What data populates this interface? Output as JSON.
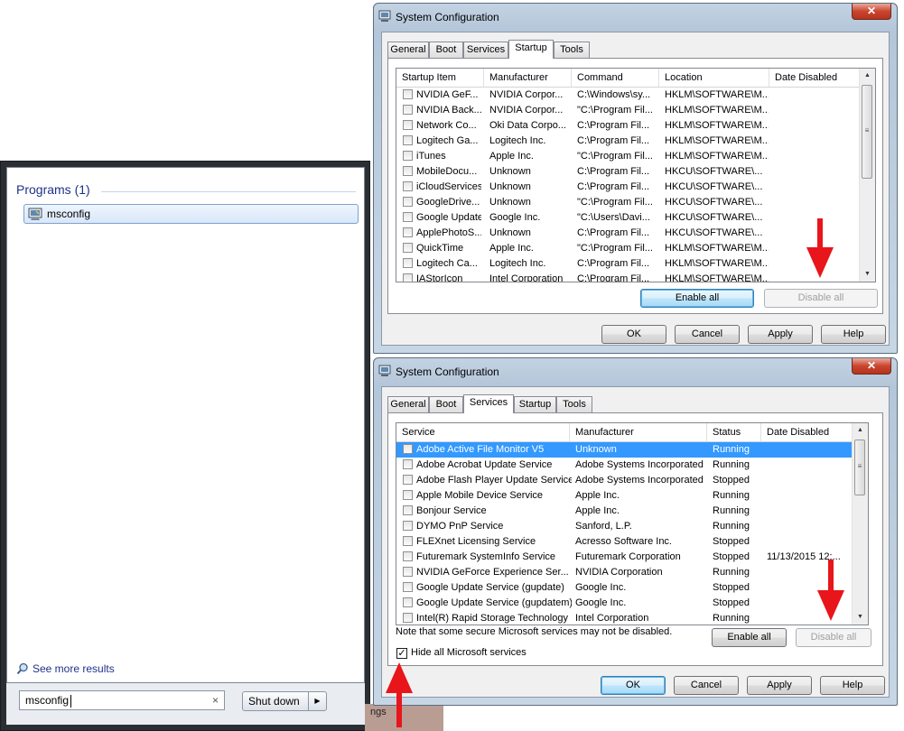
{
  "start_menu": {
    "programs_heading": "Programs (1)",
    "result_label": "msconfig",
    "see_more": "See more results",
    "search_value": "msconfig",
    "search_clear": "×",
    "shutdown_label": "Shut down",
    "shutdown_arrow": "▶"
  },
  "background": {
    "fragment_text": "ngs"
  },
  "colors": {
    "arrow": "#e8151b",
    "selection": "#3399ff",
    "accent": "#1e3287"
  },
  "window_startup": {
    "title": "System Configuration",
    "close_glyph": "✕",
    "tabs": [
      {
        "label": "General",
        "active": false
      },
      {
        "label": "Boot",
        "active": false
      },
      {
        "label": "Services",
        "active": false
      },
      {
        "label": "Startup",
        "active": true
      },
      {
        "label": "Tools",
        "active": false
      }
    ],
    "columns": [
      "Startup Item",
      "Manufacturer",
      "Command",
      "Location",
      "Date Disabled"
    ],
    "rows": [
      [
        "NVIDIA GeF...",
        "NVIDIA Corpor...",
        "C:\\Windows\\sy...",
        "HKLM\\SOFTWARE\\M...",
        ""
      ],
      [
        "NVIDIA Back...",
        "NVIDIA Corpor...",
        "\"C:\\Program Fil...",
        "HKLM\\SOFTWARE\\M...",
        ""
      ],
      [
        "Network Co...",
        "Oki Data Corpo...",
        "C:\\Program Fil...",
        "HKLM\\SOFTWARE\\M...",
        ""
      ],
      [
        "Logitech Ga...",
        "Logitech Inc.",
        "C:\\Program Fil...",
        "HKLM\\SOFTWARE\\M...",
        ""
      ],
      [
        "iTunes",
        "Apple Inc.",
        "\"C:\\Program Fil...",
        "HKLM\\SOFTWARE\\M...",
        ""
      ],
      [
        "MobileDocu...",
        "Unknown",
        "C:\\Program Fil...",
        "HKCU\\SOFTWARE\\...",
        ""
      ],
      [
        "iCloudServices",
        "Unknown",
        "C:\\Program Fil...",
        "HKCU\\SOFTWARE\\...",
        ""
      ],
      [
        "GoogleDrive...",
        "Unknown",
        "\"C:\\Program Fil...",
        "HKCU\\SOFTWARE\\...",
        ""
      ],
      [
        "Google Update",
        "Google Inc.",
        "\"C:\\Users\\Davi...",
        "HKCU\\SOFTWARE\\...",
        ""
      ],
      [
        "ApplePhotoS...",
        "Unknown",
        "C:\\Program Fil...",
        "HKCU\\SOFTWARE\\...",
        ""
      ],
      [
        "QuickTime",
        "Apple Inc.",
        "\"C:\\Program Fil...",
        "HKLM\\SOFTWARE\\M...",
        ""
      ],
      [
        "Logitech Ca...",
        "Logitech Inc.",
        "C:\\Program Fil...",
        "HKLM\\SOFTWARE\\M...",
        ""
      ],
      [
        "IAStorIcon",
        "Intel Corporation",
        "C:\\Program Fil...",
        "HKLM\\SOFTWARE\\M...",
        ""
      ]
    ],
    "enable_all": "Enable all",
    "disable_all": "Disable all",
    "ok": "OK",
    "cancel": "Cancel",
    "apply": "Apply",
    "help": "Help"
  },
  "window_services": {
    "title": "System Configuration",
    "close_glyph": "✕",
    "tabs": [
      {
        "label": "General",
        "active": false
      },
      {
        "label": "Boot",
        "active": false
      },
      {
        "label": "Services",
        "active": true
      },
      {
        "label": "Startup",
        "active": false
      },
      {
        "label": "Tools",
        "active": false
      }
    ],
    "columns": [
      "Service",
      "Manufacturer",
      "Status",
      "Date Disabled"
    ],
    "rows": [
      [
        "Adobe Active File Monitor V5",
        "Unknown",
        "Running",
        ""
      ],
      [
        "Adobe Acrobat Update Service",
        "Adobe Systems Incorporated",
        "Running",
        ""
      ],
      [
        "Adobe Flash Player Update Service",
        "Adobe Systems Incorporated",
        "Stopped",
        ""
      ],
      [
        "Apple Mobile Device Service",
        "Apple Inc.",
        "Running",
        ""
      ],
      [
        "Bonjour Service",
        "Apple Inc.",
        "Running",
        ""
      ],
      [
        "DYMO PnP Service",
        "Sanford, L.P.",
        "Running",
        ""
      ],
      [
        "FLEXnet Licensing Service",
        "Acresso Software Inc.",
        "Stopped",
        ""
      ],
      [
        "Futuremark SystemInfo Service",
        "Futuremark Corporation",
        "Stopped",
        "11/13/2015 12:..."
      ],
      [
        "NVIDIA GeForce Experience Ser...",
        "NVIDIA Corporation",
        "Running",
        ""
      ],
      [
        "Google Update Service (gupdate)",
        "Google Inc.",
        "Stopped",
        ""
      ],
      [
        "Google Update Service (gupdatem)",
        "Google Inc.",
        "Stopped",
        ""
      ],
      [
        "Intel(R) Rapid Storage Technology",
        "Intel Corporation",
        "Running",
        ""
      ]
    ],
    "selected_row": 0,
    "note": "Note that some secure Microsoft services may not be disabled.",
    "enable_all": "Enable all",
    "disable_all": "Disable all",
    "hide_ms_label": "Hide all Microsoft services",
    "hide_ms_checked": true,
    "ok": "OK",
    "cancel": "Cancel",
    "apply": "Apply",
    "help": "Help"
  }
}
